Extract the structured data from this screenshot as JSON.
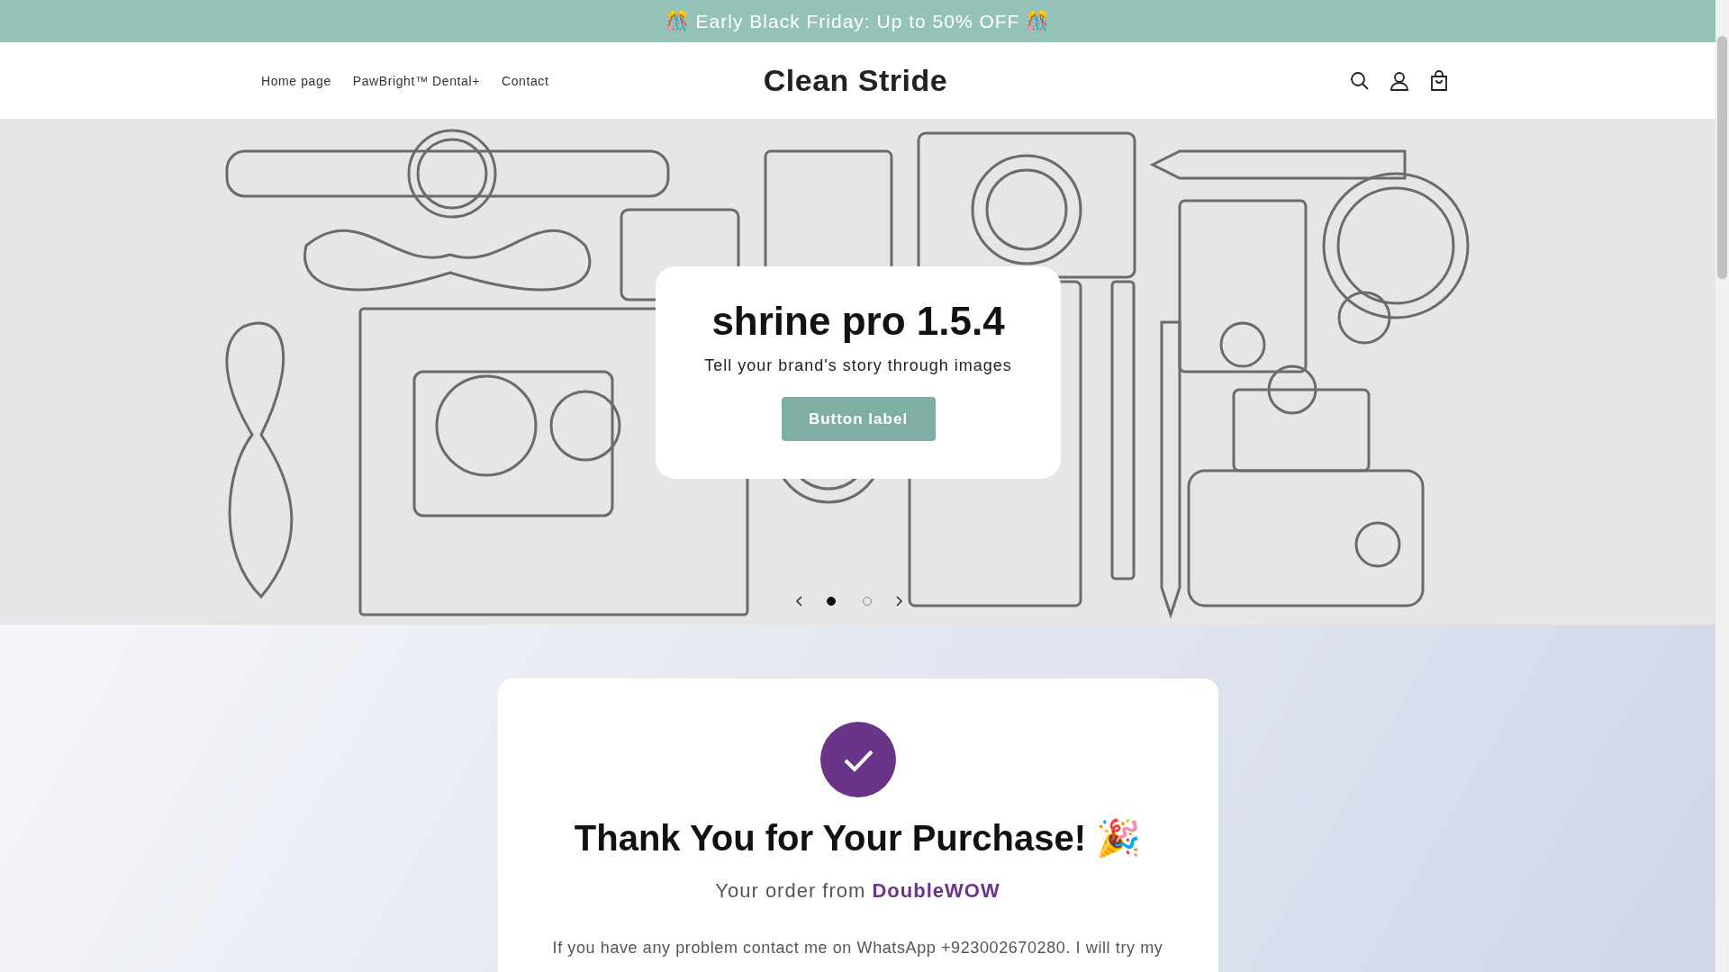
{
  "announcement": "🎊 Early Black Friday: Up to 50% OFF 🎊",
  "nav": [
    {
      "label": "Home page"
    },
    {
      "label": "PawBright™ Dental+"
    },
    {
      "label": "Contact"
    }
  ],
  "logo": "Clean Stride",
  "hero": {
    "title": "shrine pro 1.5.4",
    "subtitle": "Tell your brand's story through images",
    "button": "Button label",
    "slides": [
      {
        "selected": true
      },
      {
        "selected": false
      }
    ]
  },
  "thanks": {
    "heading": "Thank You for Your Purchase! 🎉",
    "order": "Your order from **DoubleWOW**",
    "message": "If you have any problem contact me on WhatsApp +923002670280. I will try my"
  }
}
